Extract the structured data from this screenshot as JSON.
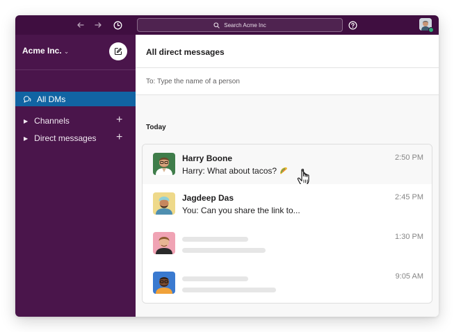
{
  "topbar": {
    "back_icon": "arrow-left-icon",
    "forward_icon": "arrow-right-icon",
    "history_icon": "clock-icon",
    "search_placeholder": "Search Acme Inc",
    "help_icon": "question-circle-icon"
  },
  "sidebar": {
    "workspace_name": "Acme Inc.",
    "workspace_chevron": "⌄",
    "nav_all_dms": "All DMs",
    "sections": [
      {
        "label": "Channels"
      },
      {
        "label": "Direct messages"
      }
    ],
    "plus_symbol": "+"
  },
  "main": {
    "title": "All direct messages",
    "to_prompt": "To: Type the name of a person",
    "today_label": "Today",
    "dms": [
      {
        "name": "Harry Boone",
        "message": "Harry: What about tacos?",
        "time": "2:50 PM",
        "avatar_color": "#3f7d4a"
      },
      {
        "name": "Jagdeep Das",
        "message": "You: Can you share the link to...",
        "time": "2:45 PM",
        "avatar_color": "#e9c45a"
      },
      {
        "name": "",
        "message": "",
        "time": "1:30 PM",
        "avatar_color": "#e85b7a"
      },
      {
        "name": "",
        "message": "",
        "time": "9:05 AM",
        "avatar_color": "#3a7ad0"
      }
    ]
  },
  "colors": {
    "topbar": "#3f0e40",
    "sidebar": "#4a154b",
    "active_nav": "#1164a3",
    "presence": "#2bac76"
  }
}
